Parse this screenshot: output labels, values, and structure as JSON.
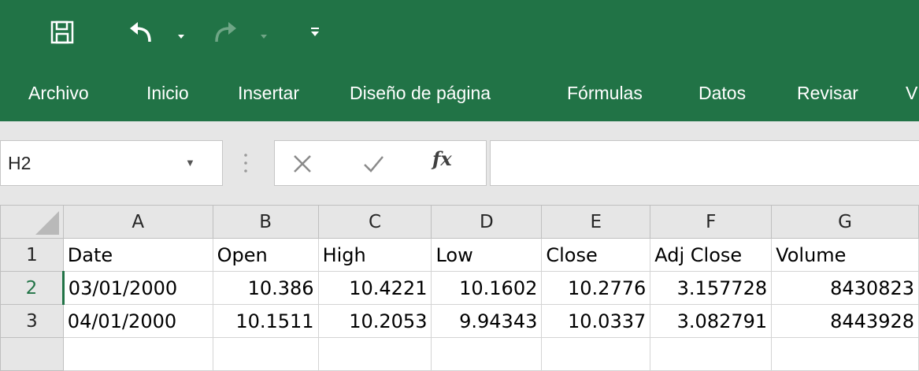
{
  "quick_access": {
    "icons": [
      "save-icon",
      "undo-icon",
      "undo-dropdown-icon",
      "redo-icon",
      "redo-dropdown-icon",
      "customize-qat-icon"
    ]
  },
  "menu": {
    "items": [
      "Archivo",
      "Inicio",
      "Insertar",
      "Diseño de página",
      "Fórmulas",
      "Datos",
      "Revisar",
      "V"
    ]
  },
  "formula_bar": {
    "name_box": "H2",
    "function_label": "fx",
    "formula": ""
  },
  "sheet": {
    "columns": [
      "A",
      "B",
      "C",
      "D",
      "E",
      "F",
      "G"
    ],
    "row_numbers": [
      "1",
      "2",
      "3"
    ],
    "header_row": [
      "Date",
      "Open",
      "High",
      "Low",
      "Close",
      "Adj Close",
      "Volume"
    ],
    "rows": [
      [
        "03/01/2000",
        "10.386",
        "10.4221",
        "10.1602",
        "10.2776",
        "3.157728",
        "8430823"
      ],
      [
        "04/01/2000",
        "10.1511",
        "10.2053",
        "9.94343",
        "10.0337",
        "3.082791",
        "8443928"
      ]
    ]
  },
  "colors": {
    "ribbon": "#217346",
    "formula_bar_bg": "#e6e6e6",
    "header_bg": "#e6e6e6",
    "active_indicator": "#217346"
  }
}
